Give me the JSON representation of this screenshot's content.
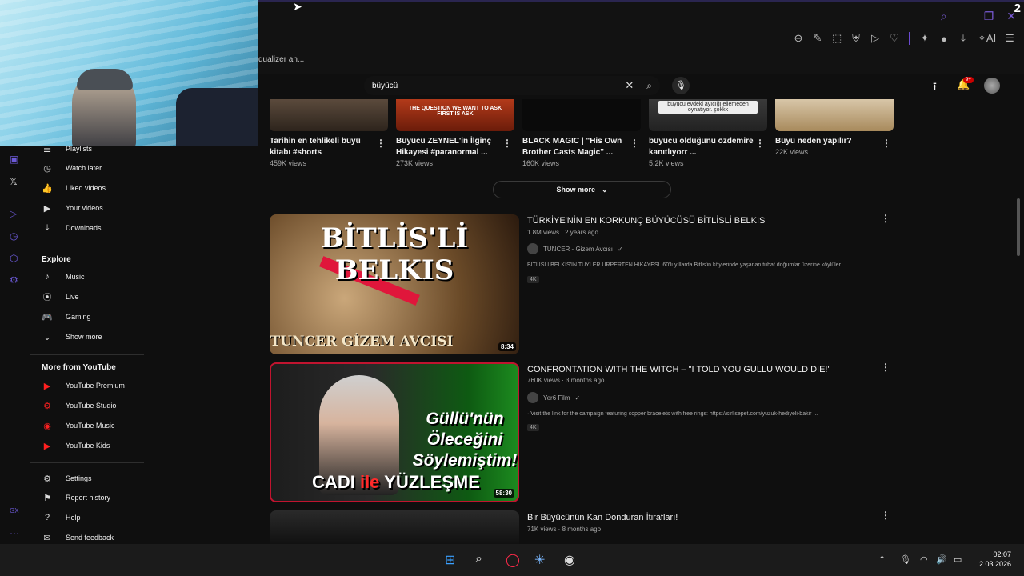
{
  "browser": {
    "tab_snippet": "qualizer an...",
    "corner_number": "2"
  },
  "search": {
    "value": "büyücü"
  },
  "header": {
    "notif_badge": "9+"
  },
  "sidebar": {
    "items_top": [
      {
        "label": "Playlists",
        "icon": "playlist-icon"
      },
      {
        "label": "Watch later",
        "icon": "clock-icon"
      },
      {
        "label": "Liked videos",
        "icon": "thumb-up-icon"
      },
      {
        "label": "Your videos",
        "icon": "video-icon"
      },
      {
        "label": "Downloads",
        "icon": "download-icon"
      }
    ],
    "explore_heading": "Explore",
    "explore": [
      {
        "label": "Music",
        "icon": "music-icon"
      },
      {
        "label": "Live",
        "icon": "live-icon"
      },
      {
        "label": "Gaming",
        "icon": "gaming-icon"
      },
      {
        "label": "Show more",
        "icon": "chevron-down-icon"
      }
    ],
    "more_heading": "More from YouTube",
    "more": [
      {
        "label": "YouTube Premium"
      },
      {
        "label": "YouTube Studio"
      },
      {
        "label": "YouTube Music"
      },
      {
        "label": "YouTube Kids"
      }
    ],
    "bottom": [
      {
        "label": "Settings",
        "icon": "gear-icon"
      },
      {
        "label": "Report history",
        "icon": "flag-icon"
      },
      {
        "label": "Help",
        "icon": "help-icon"
      },
      {
        "label": "Send feedback",
        "icon": "feedback-icon"
      }
    ]
  },
  "shorts": [
    {
      "title1": "Tarihin en tehlikeli büyü",
      "title2": "kitabı #shorts",
      "views": "459K views",
      "overlay": ""
    },
    {
      "title1": "Büyücü ZEYNEL'in İlginç",
      "title2": "Hikayesi #paranormal ...",
      "views": "273K views",
      "overlay": "THE QUESTION WE WANT TO ASK FIRST IS ASK"
    },
    {
      "title1": "BLACK MAGIC | \"His Own",
      "title2": "Brother Casts Magic\" ...",
      "views": "160K views",
      "overlay": ""
    },
    {
      "title1": "büyücü olduğunu özdemire",
      "title2": "kanıtlıyorr ...",
      "views": "5.2K views",
      "overlay": "büyücü evdeki ayıcığı ellemeden oynatıyor. şokkk"
    },
    {
      "title1": "Büyü neden yapılır?",
      "title2": "",
      "views": "22K views",
      "overlay": ""
    }
  ],
  "show_more": "Show more",
  "videos": [
    {
      "title": "TÜRKİYE'NİN EN KORKUNÇ BÜYÜCÜSÜ BİTLİSLİ BELKIS",
      "meta": "1.8M views · 2 years ago",
      "channel": "TUNCER - Gizem Avcısı",
      "desc": "BİTLİSLİ BELKIS'IN TÜYLER ÜRPERTEN HİKAYESİ. 60'lı yıllarda Bitlis'in köylerinde yaşanan tuhaf doğumlar üzerine köylüler ...",
      "badge": "4K",
      "duration": "8:34",
      "thumb_top": "BİTLİS'Lİ BELKIS",
      "thumb_bottom": "TUNCER GİZEM AVCISI"
    },
    {
      "title": "CONFRONTATION WITH THE WITCH – \"I TOLD YOU GULLU WOULD DIE!\"",
      "meta": "760K views · 3 months ago",
      "channel": "Yer6 Film",
      "desc": "· Visit the link for the campaign featuring copper bracelets with free rings: https://sirlisepet.com/yuzuk-hediyeli-bakir ...",
      "badge": "4K",
      "duration": "58:30",
      "thumb_mid1": "Güllü'nün",
      "thumb_mid2": "Öleceğini",
      "thumb_mid3": "Söylemiştim!",
      "thumb_bottom1": "CADI",
      "thumb_bottom2": "ile",
      "thumb_bottom3": "YÜZLEŞME"
    },
    {
      "title": "Bir Büyücünün Kan Donduran İtirafları!",
      "meta": "71K views · 8 months ago"
    }
  ],
  "taskbar": {
    "time": "02:07",
    "date": "2.03.2026"
  }
}
